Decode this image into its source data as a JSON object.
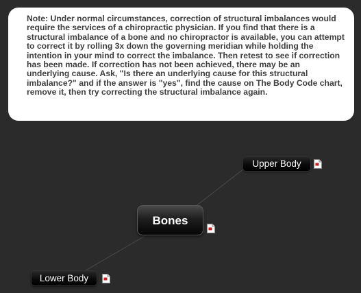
{
  "note": {
    "text": "Note: Under normal circumstances, correction of structural imbalances would require the services of a chiropractic physician. If you find that there is a structural imbalance of a bone and no chiropractor is available, you can attempt to correct it by rolling 3x down the governing meridian while holding the intention in your mind to correct the imbalance. Then retest to see if correction has been made. If correction has not been achieved, there may be an underlying cause. Ask, \"Is there an underlying cause for this structural imbalance?\" and if the answer is \"yes\", find the cause on The Body Code chart, remove it, then try correcting the structural imbalance again."
  },
  "mindmap": {
    "center": {
      "label": "Bones",
      "icon": "document-icon"
    },
    "branches": [
      {
        "label": "Upper Body",
        "icon": "document-icon"
      },
      {
        "label": "Lower Body",
        "icon": "document-icon"
      }
    ]
  },
  "colors": {
    "background": "#2b2b2b",
    "note_background": "#ffffff",
    "note_text": "#3e3e3e",
    "node_text": "#ffffff",
    "connector": "#4a4a4a",
    "icon_accent": "#cc1f1f"
  }
}
